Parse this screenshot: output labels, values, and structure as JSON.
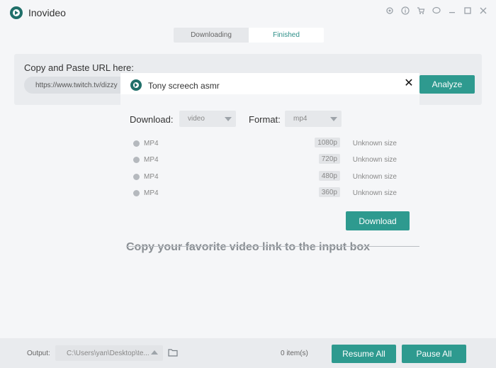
{
  "app": {
    "title": "Inovideo"
  },
  "window_icons": [
    "settings-icon",
    "info-icon",
    "cart-icon",
    "chat-icon",
    "minimize-icon",
    "maximize-icon",
    "close-icon"
  ],
  "tabs": [
    {
      "label": "Downloading",
      "active": false
    },
    {
      "label": "Finished",
      "active": true
    }
  ],
  "url_panel": {
    "label": "Copy and Paste URL here:",
    "value": "https://www.twitch.tv/dizzy",
    "analyze_label": "Analyze"
  },
  "empty_state": {
    "text": "Copy your favorite video link to the input box"
  },
  "modal": {
    "title": "Tony screech asmr",
    "download_label": "Download:",
    "download_value": "video",
    "format_label": "Format:",
    "format_value": "mp4",
    "formats": [
      {
        "name": "MP4",
        "resolution": "1080p",
        "size": "Unknown size"
      },
      {
        "name": "MP4",
        "resolution": "720p",
        "size": "Unknown size"
      },
      {
        "name": "MP4",
        "resolution": "480p",
        "size": "Unknown size"
      },
      {
        "name": "MP4",
        "resolution": "360p",
        "size": "Unknown size"
      }
    ],
    "download_button": "Download"
  },
  "bottom": {
    "output_label": "Output:",
    "output_path": "C:\\Users\\yan\\Desktop\\te...",
    "count": "0 item(s)",
    "resume_label": "Resume All",
    "pause_label": "Pause All"
  },
  "colors": {
    "accent": "#2e9a8f",
    "logo": "#1f6f69"
  }
}
